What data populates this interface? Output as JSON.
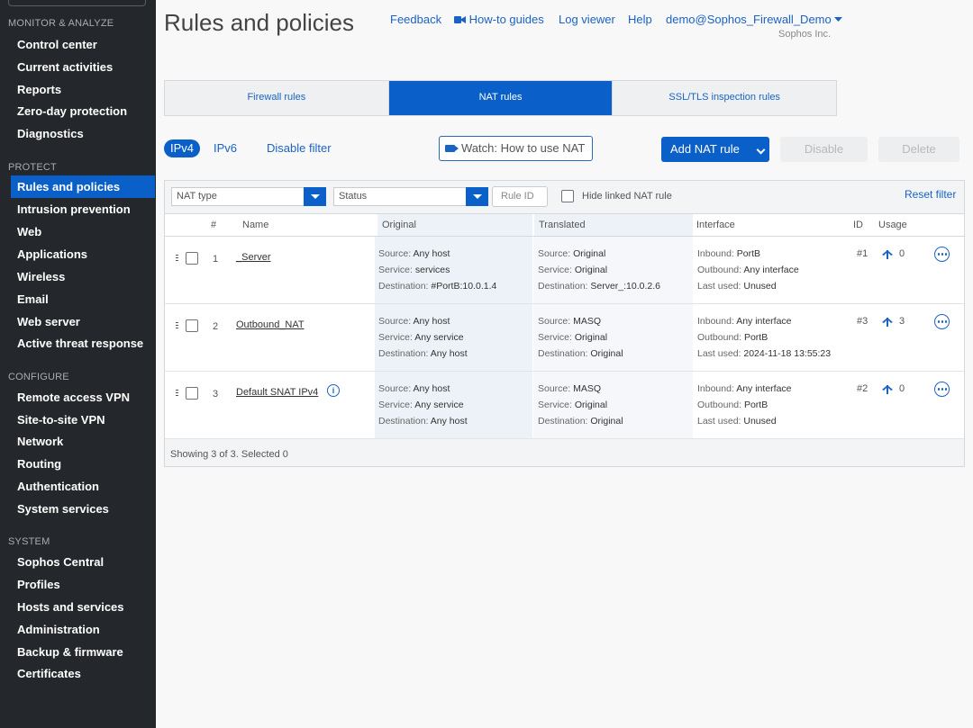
{
  "sidebar": {
    "sections": [
      {
        "title": "MONITOR & ANALYZE",
        "items": [
          "Control center",
          "Current activities",
          "Reports",
          "Zero-day protection",
          "Diagnostics"
        ]
      },
      {
        "title": "PROTECT",
        "items": [
          "Rules and policies",
          "Intrusion prevention",
          "Web",
          "Applications",
          "Wireless",
          "Email",
          "Web server",
          "Active threat response"
        ]
      },
      {
        "title": "CONFIGURE",
        "items": [
          "Remote access VPN",
          "Site-to-site VPN",
          "Network",
          "Routing",
          "Authentication",
          "System services"
        ]
      },
      {
        "title": "SYSTEM",
        "items": [
          "Sophos Central",
          "Profiles",
          "Hosts and services",
          "Administration",
          "Backup & firmware",
          "Certificates"
        ]
      }
    ],
    "active_item": "Rules and policies"
  },
  "header": {
    "title": "Rules and policies",
    "links": {
      "feedback": "Feedback",
      "howto": "How-to guides",
      "log": "Log viewer",
      "help": "Help",
      "user": "demo@Sophos_Firewall_Demo"
    },
    "company": "Sophos Inc."
  },
  "tabs": [
    "Firewall rules",
    "NAT rules",
    "SSL/TLS inspection rules"
  ],
  "active_tab": "NAT rules",
  "toolbar": {
    "ipv4": "IPv4",
    "ipv6": "IPv6",
    "disable_filter": "Disable filter",
    "watch": "Watch: How to use NAT",
    "add": "Add NAT rule",
    "disable": "Disable",
    "delete": "Delete"
  },
  "filters": {
    "nat_type": "NAT type",
    "status": "Status",
    "rule_id": "Rule ID",
    "hide_linked": "Hide linked NAT rule",
    "reset": "Reset filter"
  },
  "table": {
    "columns": {
      "num": "#",
      "name": "Name",
      "original": "Original",
      "translated": "Translated",
      "interface": "Interface",
      "id": "ID",
      "usage": "Usage"
    },
    "labels": {
      "source": "Source:",
      "service": "Service:",
      "destination": "Destination:",
      "inbound": "Inbound:",
      "outbound": "Outbound:",
      "last_used": "Last used:"
    },
    "rows": [
      {
        "num": "1",
        "name": "_Server",
        "orig": {
          "source": "Any host",
          "service": "services",
          "destination": "#PortB:10.0.1.4"
        },
        "trans": {
          "source": "Original",
          "service": "Original",
          "destination": "Server_:10.0.2.6"
        },
        "iface": {
          "inbound": "PortB",
          "outbound": "Any interface",
          "last_used": "Unused"
        },
        "id": "#1",
        "usage": "0"
      },
      {
        "num": "2",
        "name": "Outbound_NAT",
        "orig": {
          "source": "Any host",
          "service": "Any service",
          "destination": "Any host"
        },
        "trans": {
          "source": "MASQ",
          "service": "Original",
          "destination": "Original"
        },
        "iface": {
          "inbound": "Any interface",
          "outbound": "PortB",
          "last_used": "2024-11-18 13:55:23"
        },
        "id": "#3",
        "usage": "3"
      },
      {
        "num": "3",
        "name": "Default SNAT IPv4",
        "orig": {
          "source": "Any host",
          "service": "Any service",
          "destination": "Any host"
        },
        "trans": {
          "source": "MASQ",
          "service": "Original",
          "destination": "Original"
        },
        "iface": {
          "inbound": "Any interface",
          "outbound": "PortB",
          "last_used": "Unused"
        },
        "id": "#2",
        "usage": "0"
      }
    ],
    "footer": "Showing 3 of 3. Selected 0"
  },
  "colors": {
    "accent": "#0a60c8",
    "sidebar_bg": "#24272b",
    "link": "#1a63c4"
  }
}
